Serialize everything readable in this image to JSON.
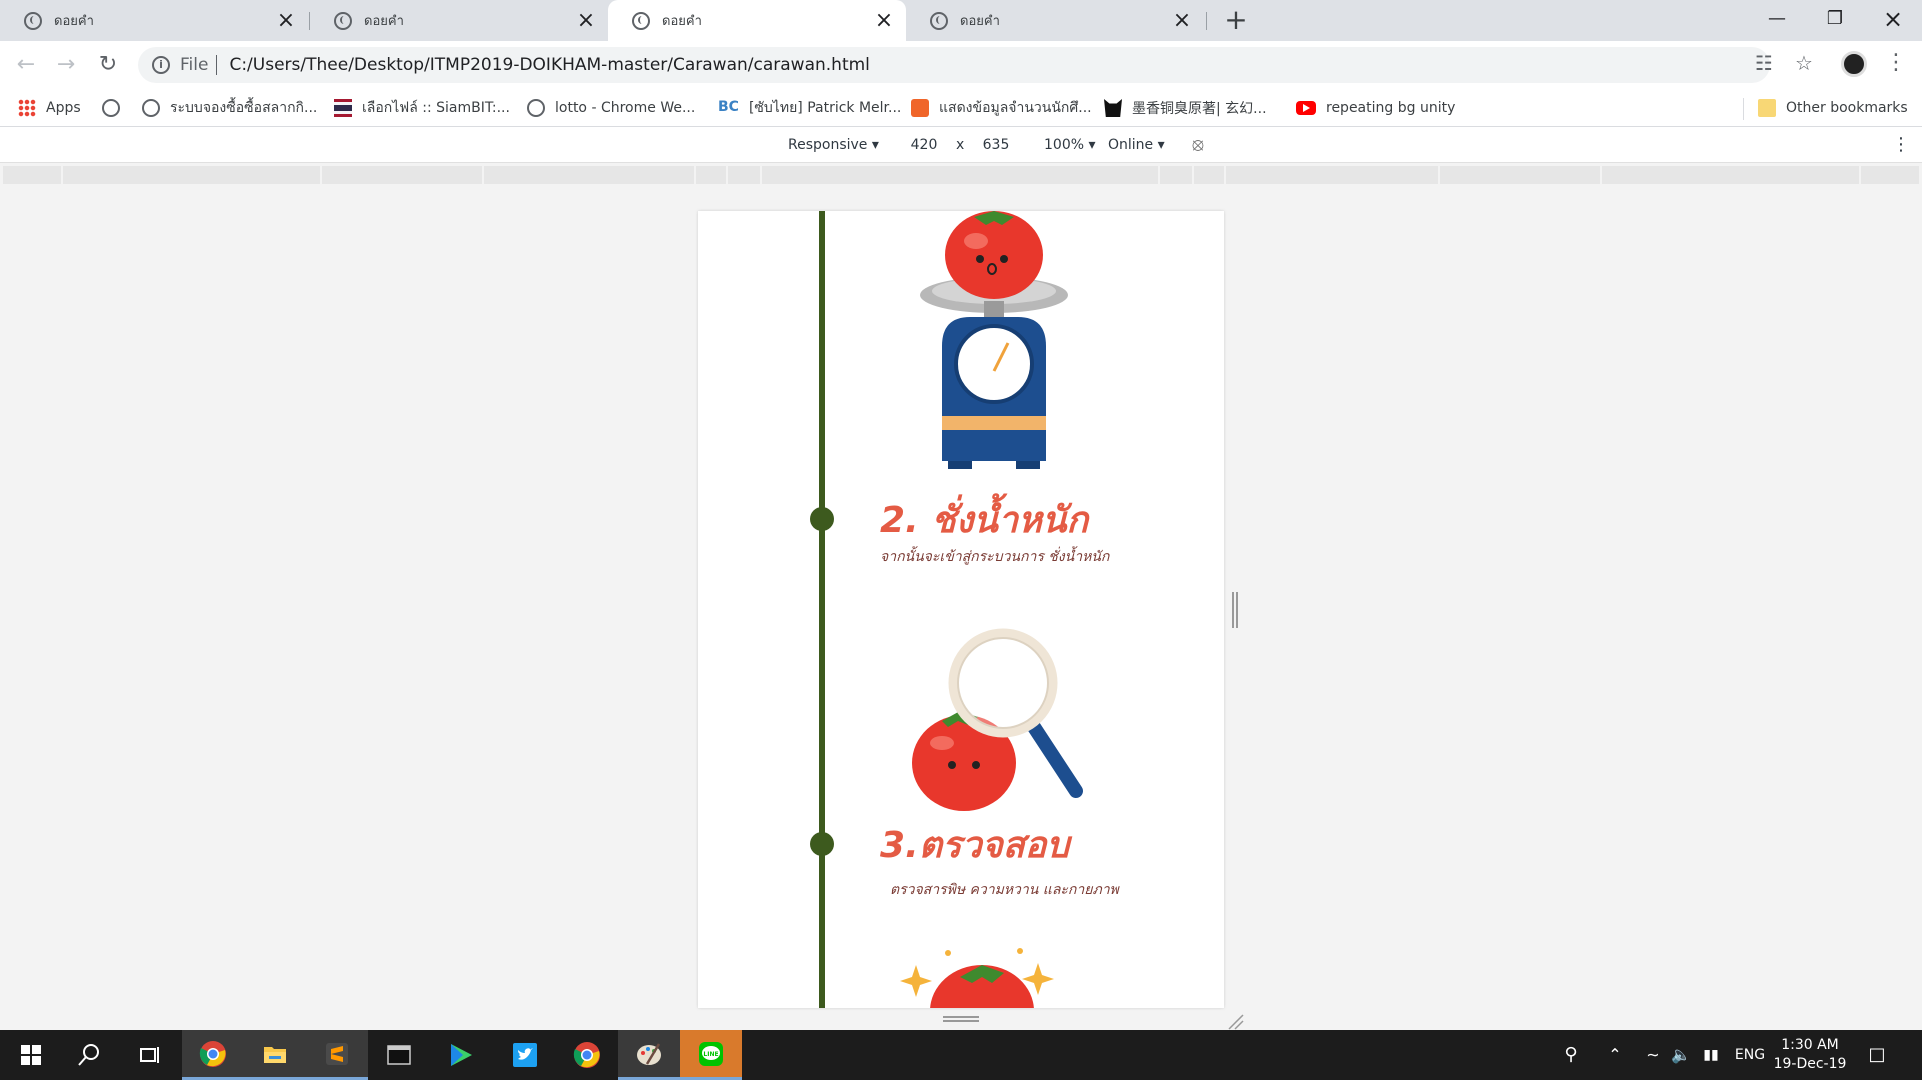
{
  "tabs": [
    {
      "title": "ดอยคำ"
    },
    {
      "title": "ดอยคำ"
    },
    {
      "title": "ดอยคำ"
    },
    {
      "title": "ดอยคำ"
    }
  ],
  "new_tab_icon": "plus-icon",
  "omnibox": {
    "scheme": "File",
    "url": "C:/Users/Thee/Desktop/ITMP2019-DOIKHAM-master/Carawan/carawan.html"
  },
  "bookmarks": [
    {
      "label": "Apps",
      "icon": "apps-icon"
    },
    {
      "label": "",
      "icon": "globe-icon"
    },
    {
      "label": "ระบบจองซื้อซื้อสลากกิ...",
      "icon": "globe-icon"
    },
    {
      "label": "เลือกไฟล์ :: SiamBIT:...",
      "icon": "thai-flag-icon"
    },
    {
      "label": "lotto - Chrome We...",
      "icon": "globe-icon"
    },
    {
      "label": "[ซับไทย] Patrick Melr...",
      "icon": "bc-icon"
    },
    {
      "label": "แสดงข้อมูลจำนวนนักศึ...",
      "icon": "html-icon"
    },
    {
      "label": "墨香铜臭原著| 玄幻...",
      "icon": "cat-icon"
    },
    {
      "label": "repeating bg unity",
      "icon": "youtube-icon"
    },
    {
      "label": "Other bookmarks",
      "icon": "folder-icon"
    }
  ],
  "devtools": {
    "device": "Responsive",
    "width": "420",
    "times": "x",
    "height": "635",
    "zoom": "100%",
    "network": "Online"
  },
  "page": {
    "steps": [
      {
        "title": "2. ชั่งน้ำหนัก",
        "subtitle": "จากนั้นจะเข้าสู่กระบวนการ ชั่งน้ำหนัก"
      },
      {
        "title": "3.ตรวจสอบ",
        "subtitle": "ตรวจสารพิษ ความหวาน  และกายภาพ"
      }
    ],
    "colors": {
      "timeline": "#3d5a1e",
      "title": "#e45b44",
      "subtitle": "#7a3b34",
      "tomato": "#e8372c"
    }
  },
  "taskbar": {
    "apps": [
      "start-icon",
      "search-icon",
      "task-view-icon",
      "chrome-icon",
      "file-explorer-icon",
      "sublime-icon",
      "terminal-icon",
      "play-icon",
      "twitter-icon",
      "chrome-icon",
      "paint-icon",
      "line-icon"
    ],
    "lang": "ENG",
    "time": "1:30 AM",
    "date": "19-Dec-19"
  }
}
